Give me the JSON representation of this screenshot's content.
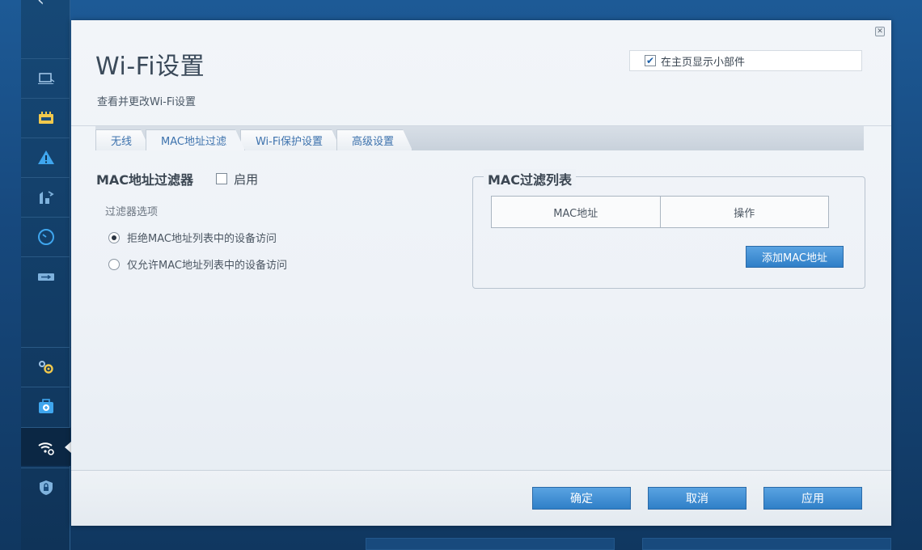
{
  "colors": {
    "accent": "#2f7fc7",
    "tab_text": "#3d72ad",
    "panel_bg": "#eef2f7",
    "rail_bg": "#164876"
  },
  "sidebar": {
    "items": [
      {
        "icon": "laptop-icon"
      },
      {
        "icon": "router-icon"
      },
      {
        "icon": "warning-icon"
      },
      {
        "icon": "parental-control-icon"
      },
      {
        "icon": "clock-icon"
      },
      {
        "icon": "usb-icon"
      },
      {
        "icon": "gears-icon"
      },
      {
        "icon": "health-icon"
      },
      {
        "icon": "wifi-settings-icon",
        "active": true
      },
      {
        "icon": "security-icon"
      }
    ]
  },
  "header": {
    "title": "Wi-Fi设置",
    "subtitle": "查看并更改Wi-Fi设置",
    "show_on_home_label": "在主页显示小部件",
    "show_on_home_checked": true
  },
  "tabs": [
    {
      "label": "无线"
    },
    {
      "label": "MAC地址过滤",
      "active": true
    },
    {
      "label": "Wi-Fi保护设置"
    },
    {
      "label": "高级设置"
    }
  ],
  "mac_filter": {
    "title": "MAC地址过滤器",
    "enable_label": "启用",
    "enabled": false,
    "options_label": "过滤器选项",
    "options": [
      {
        "label": "拒绝MAC地址列表中的设备访问",
        "selected": true
      },
      {
        "label": "仅允许MAC地址列表中的设备访问",
        "selected": false
      }
    ]
  },
  "mac_list": {
    "title": "MAC过滤列表",
    "columns": [
      "MAC地址",
      "操作"
    ],
    "rows": [],
    "add_button": "添加MAC地址"
  },
  "footer": {
    "ok": "确定",
    "cancel": "取消",
    "apply": "应用"
  }
}
